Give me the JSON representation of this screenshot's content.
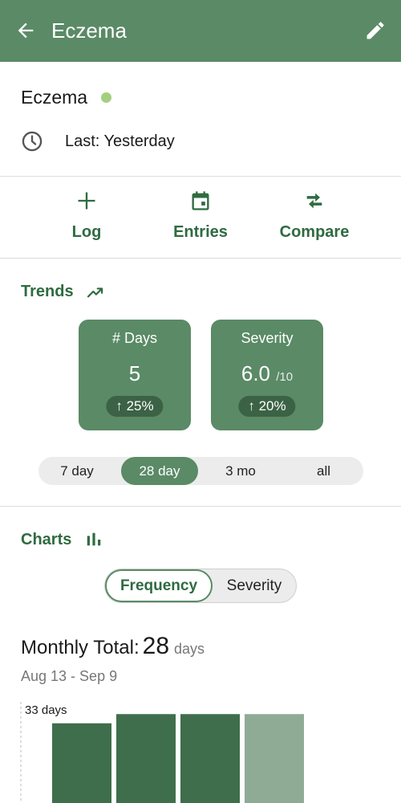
{
  "header": {
    "title": "Eczema",
    "back_icon": "arrow-left-icon",
    "edit_icon": "pencil-icon"
  },
  "condition": {
    "name": "Eczema",
    "status_color": "#a4cf7e",
    "last_label": "Last: Yesterday"
  },
  "actions": [
    {
      "label": "Log",
      "icon": "plus-icon"
    },
    {
      "label": "Entries",
      "icon": "calendar-icon"
    },
    {
      "label": "Compare",
      "icon": "compare-arrows-icon"
    }
  ],
  "trends": {
    "title": "Trends",
    "tiles": [
      {
        "label": "# Days",
        "value": "5",
        "denominator": "",
        "change": "↑ 25%"
      },
      {
        "label": "Severity",
        "value": "6.0",
        "denominator": "/10",
        "change": "↑ 20%"
      }
    ],
    "ranges": [
      "7 day",
      "28 day",
      "3 mo",
      "all"
    ],
    "selected_range": "28 day"
  },
  "charts": {
    "title": "Charts",
    "tabs": [
      "Frequency",
      "Severity"
    ],
    "selected_tab": "Frequency",
    "monthly_label": "Monthly Total:",
    "monthly_value": "28",
    "monthly_unit": "days",
    "date_range": "Aug 13 - Sep 9"
  },
  "colors": {
    "accent": "#5a8a66",
    "accent_dark": "#2f6b40",
    "bar": "#3f6e4c",
    "bar_light": "#8fab95"
  },
  "chart_data": {
    "type": "bar",
    "ymax_label": "33 days",
    "ylim": [
      0,
      33
    ],
    "values": [
      26,
      29,
      29,
      29
    ],
    "highlight_last": true
  }
}
